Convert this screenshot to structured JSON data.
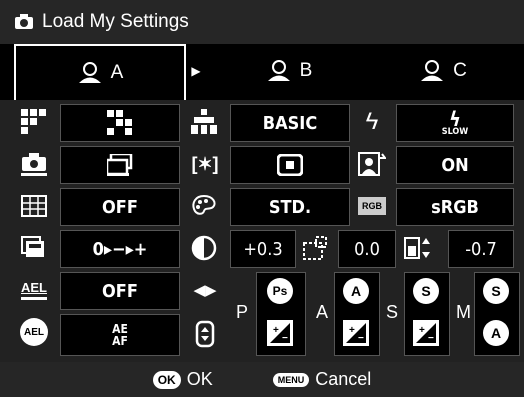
{
  "title": "Load My Settings",
  "tabs": [
    {
      "label": "A",
      "selected": true
    },
    {
      "label": "B",
      "selected": false
    },
    {
      "label": "C",
      "selected": false
    }
  ],
  "settings": {
    "drive_mode": "",
    "flash_mode": "",
    "image_quality": "BASIC",
    "flash_slow": "SLOW",
    "af_area": "",
    "face_detect": "ON",
    "metering_grid": "OFF",
    "picture_mode": "STD.",
    "color_space": "sRGB",
    "color_space_tag": "RGB",
    "bracket": "0▸−▸+",
    "exposure_comp": "+0.3",
    "flash_comp": "0.0",
    "fine_tune": "-0.7",
    "ael_button": "OFF",
    "ael_button_tag": "AEL",
    "ae_af": "AE",
    "ae_af_sub": "AF",
    "ael_circle": "AEL"
  },
  "modes": [
    "P",
    "A",
    "S",
    "M"
  ],
  "mode_badges": {
    "p_top": "Ps",
    "a_top": "A",
    "s_top": "S",
    "m_top": "S",
    "m_bottom": "A"
  },
  "footer": {
    "ok_badge": "OK",
    "ok_label": "OK",
    "cancel_badge": "MENU",
    "cancel_label": "Cancel"
  }
}
